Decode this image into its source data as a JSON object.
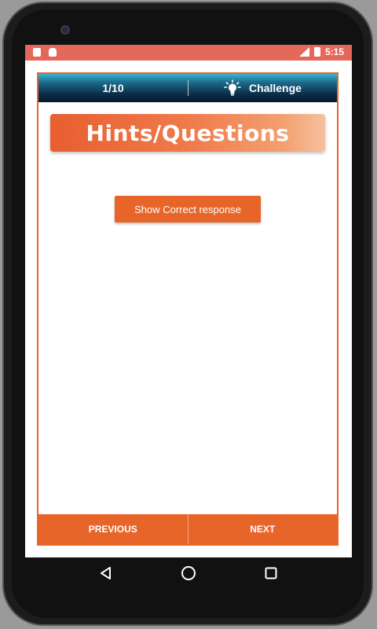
{
  "statusbar": {
    "time": "5:15",
    "left_icons": [
      "sd-card-icon",
      "android-icon"
    ],
    "right_icons": [
      "signal-icon",
      "battery-icon"
    ]
  },
  "topbar": {
    "counter": "1/10",
    "challenge_label": "Challenge",
    "challenge_icon": "lightbulb-icon"
  },
  "banner": {
    "title": "Hints/Questions"
  },
  "actions": {
    "show_correct_label": "Show Correct response"
  },
  "bottom_nav": {
    "previous_label": "PREVIOUS",
    "next_label": "NEXT"
  },
  "system_nav": {
    "back_icon": "back-triangle-icon",
    "home_icon": "home-circle-icon",
    "recents_icon": "recents-square-icon"
  },
  "colors": {
    "accent": "#e8652a",
    "statusbar": "#e4685a",
    "topbar_dark": "#06192b",
    "topbar_light": "#3ab6cf"
  }
}
